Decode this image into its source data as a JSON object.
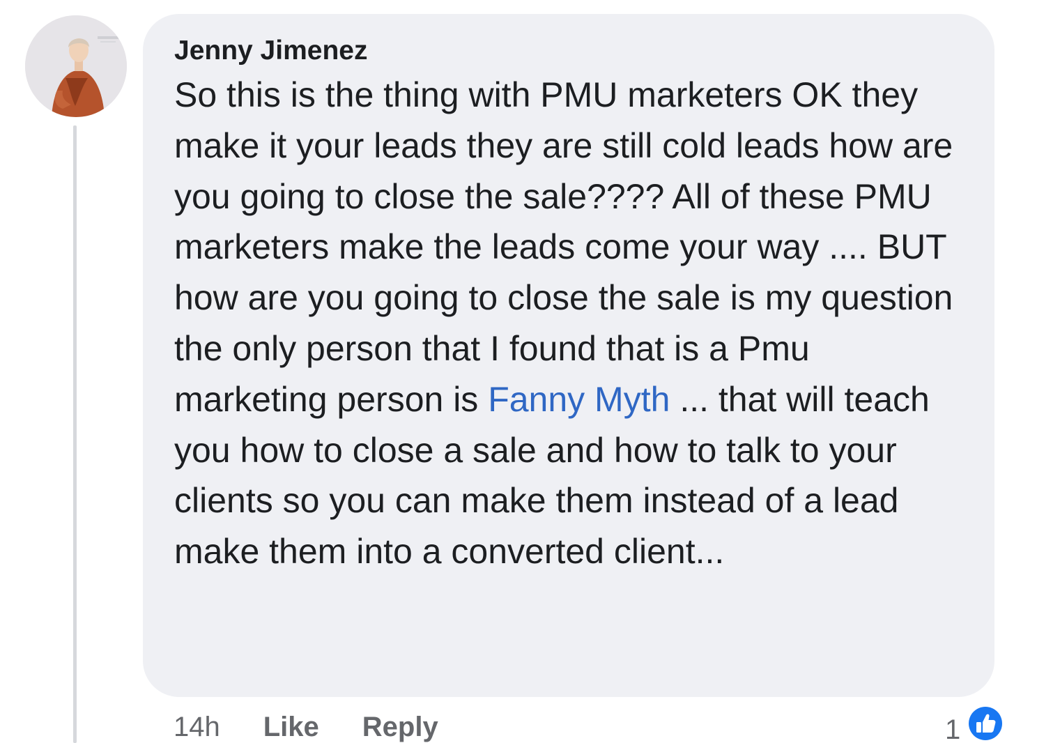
{
  "comment": {
    "author": "Jenny Jimenez",
    "text_before_mention": "So this is the thing with PMU marketers OK they make it your leads they are still cold leads how are you going to close the sale???? All of these PMU marketers make the leads come your way .... BUT how are you going to close the sale is my question the only person that I found that is a Pmu marketing person is ",
    "mention": "Fanny Myth",
    "text_after_mention": " ... that will teach you how to close a sale and how to talk to your clients so you can make them instead of a lead make them into a converted client...",
    "avatar_icon": "profile-avatar-icon"
  },
  "actions": {
    "time": "14h",
    "like_label": "Like",
    "reply_label": "Reply"
  },
  "reactions": {
    "count": "1",
    "icon": "thumbs-up-icon"
  },
  "colors": {
    "bubble_bg": "#eff0f4",
    "text": "#1c1e21",
    "mention": "#2f67c4",
    "meta": "#65676b",
    "like_blue": "#1877f2"
  }
}
